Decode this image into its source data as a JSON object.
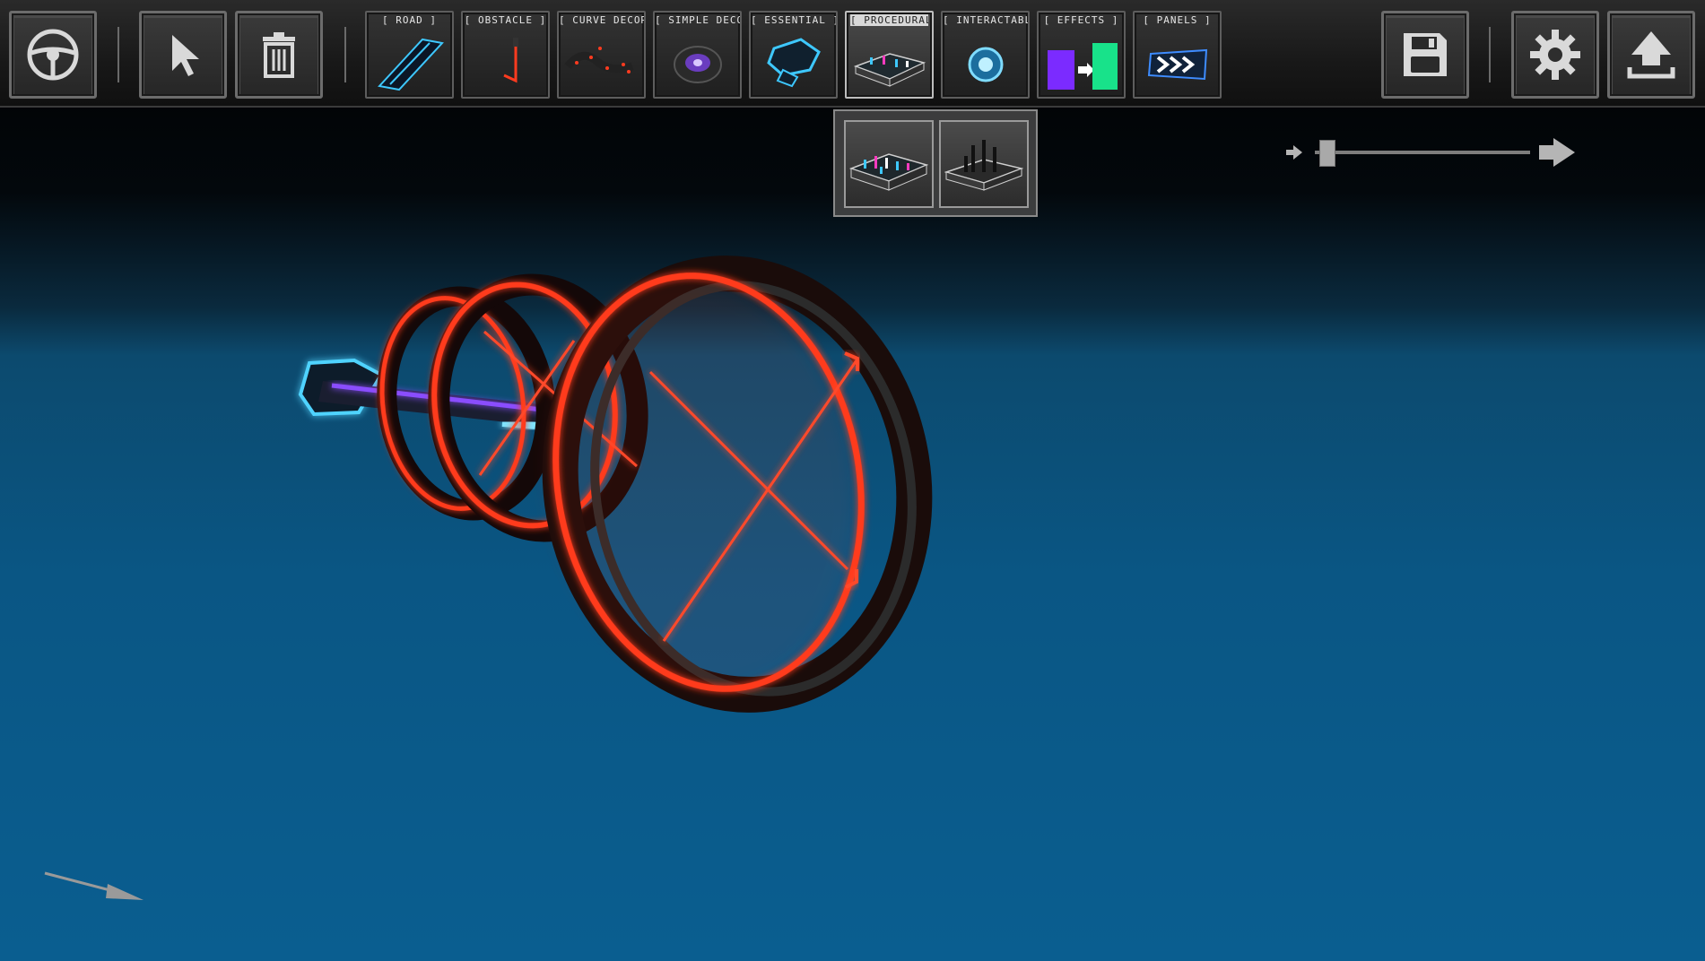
{
  "toolbar": {
    "left_tools": [
      {
        "name": "drive-mode",
        "icon": "steering-wheel-icon"
      },
      {
        "name": "select",
        "icon": "cursor-arrow-icon"
      },
      {
        "name": "delete",
        "icon": "trash-icon"
      }
    ],
    "categories": [
      {
        "label": "[ ROAD ]",
        "icon": "road-piece-icon"
      },
      {
        "label": "[ OBSTACLE ]",
        "icon": "laser-obstacle-icon"
      },
      {
        "label": "[ CURVE DECOR ]",
        "icon": "curve-decor-icon"
      },
      {
        "label": "[ SIMPLE DECOR ]",
        "icon": "simple-decor-icon"
      },
      {
        "label": "[ ESSENTIAL ]",
        "icon": "essential-piece-icon"
      },
      {
        "label": "[ PROCEDURAL ]",
        "icon": "procedural-block-icon",
        "active": true
      },
      {
        "label": "[ INTERACTABLES ]",
        "icon": "interactable-orb-icon"
      },
      {
        "label": "[ EFFECTS ]",
        "icon": "effects-color-change-icon"
      },
      {
        "label": "[ PANELS ]",
        "icon": "chevron-panel-icon"
      }
    ],
    "right_tools": [
      {
        "name": "save",
        "icon": "floppy-disk-icon"
      },
      {
        "name": "settings",
        "icon": "gear-icon"
      },
      {
        "name": "upload",
        "icon": "upload-icon"
      }
    ]
  },
  "procedural_palette": {
    "items": [
      {
        "icon": "procedural-city-block-icon"
      },
      {
        "icon": "procedural-pillars-block-icon"
      }
    ]
  },
  "zoom": {
    "level": 0.06,
    "min_icon": "arrow-small-icon",
    "max_icon": "arrow-large-icon"
  },
  "colors": {
    "neon_red": "#ff3b1f",
    "neon_blue": "#3ec8ff",
    "floor_blue": "#0a5a86",
    "toolbar_bg": "#1c1c1c"
  }
}
